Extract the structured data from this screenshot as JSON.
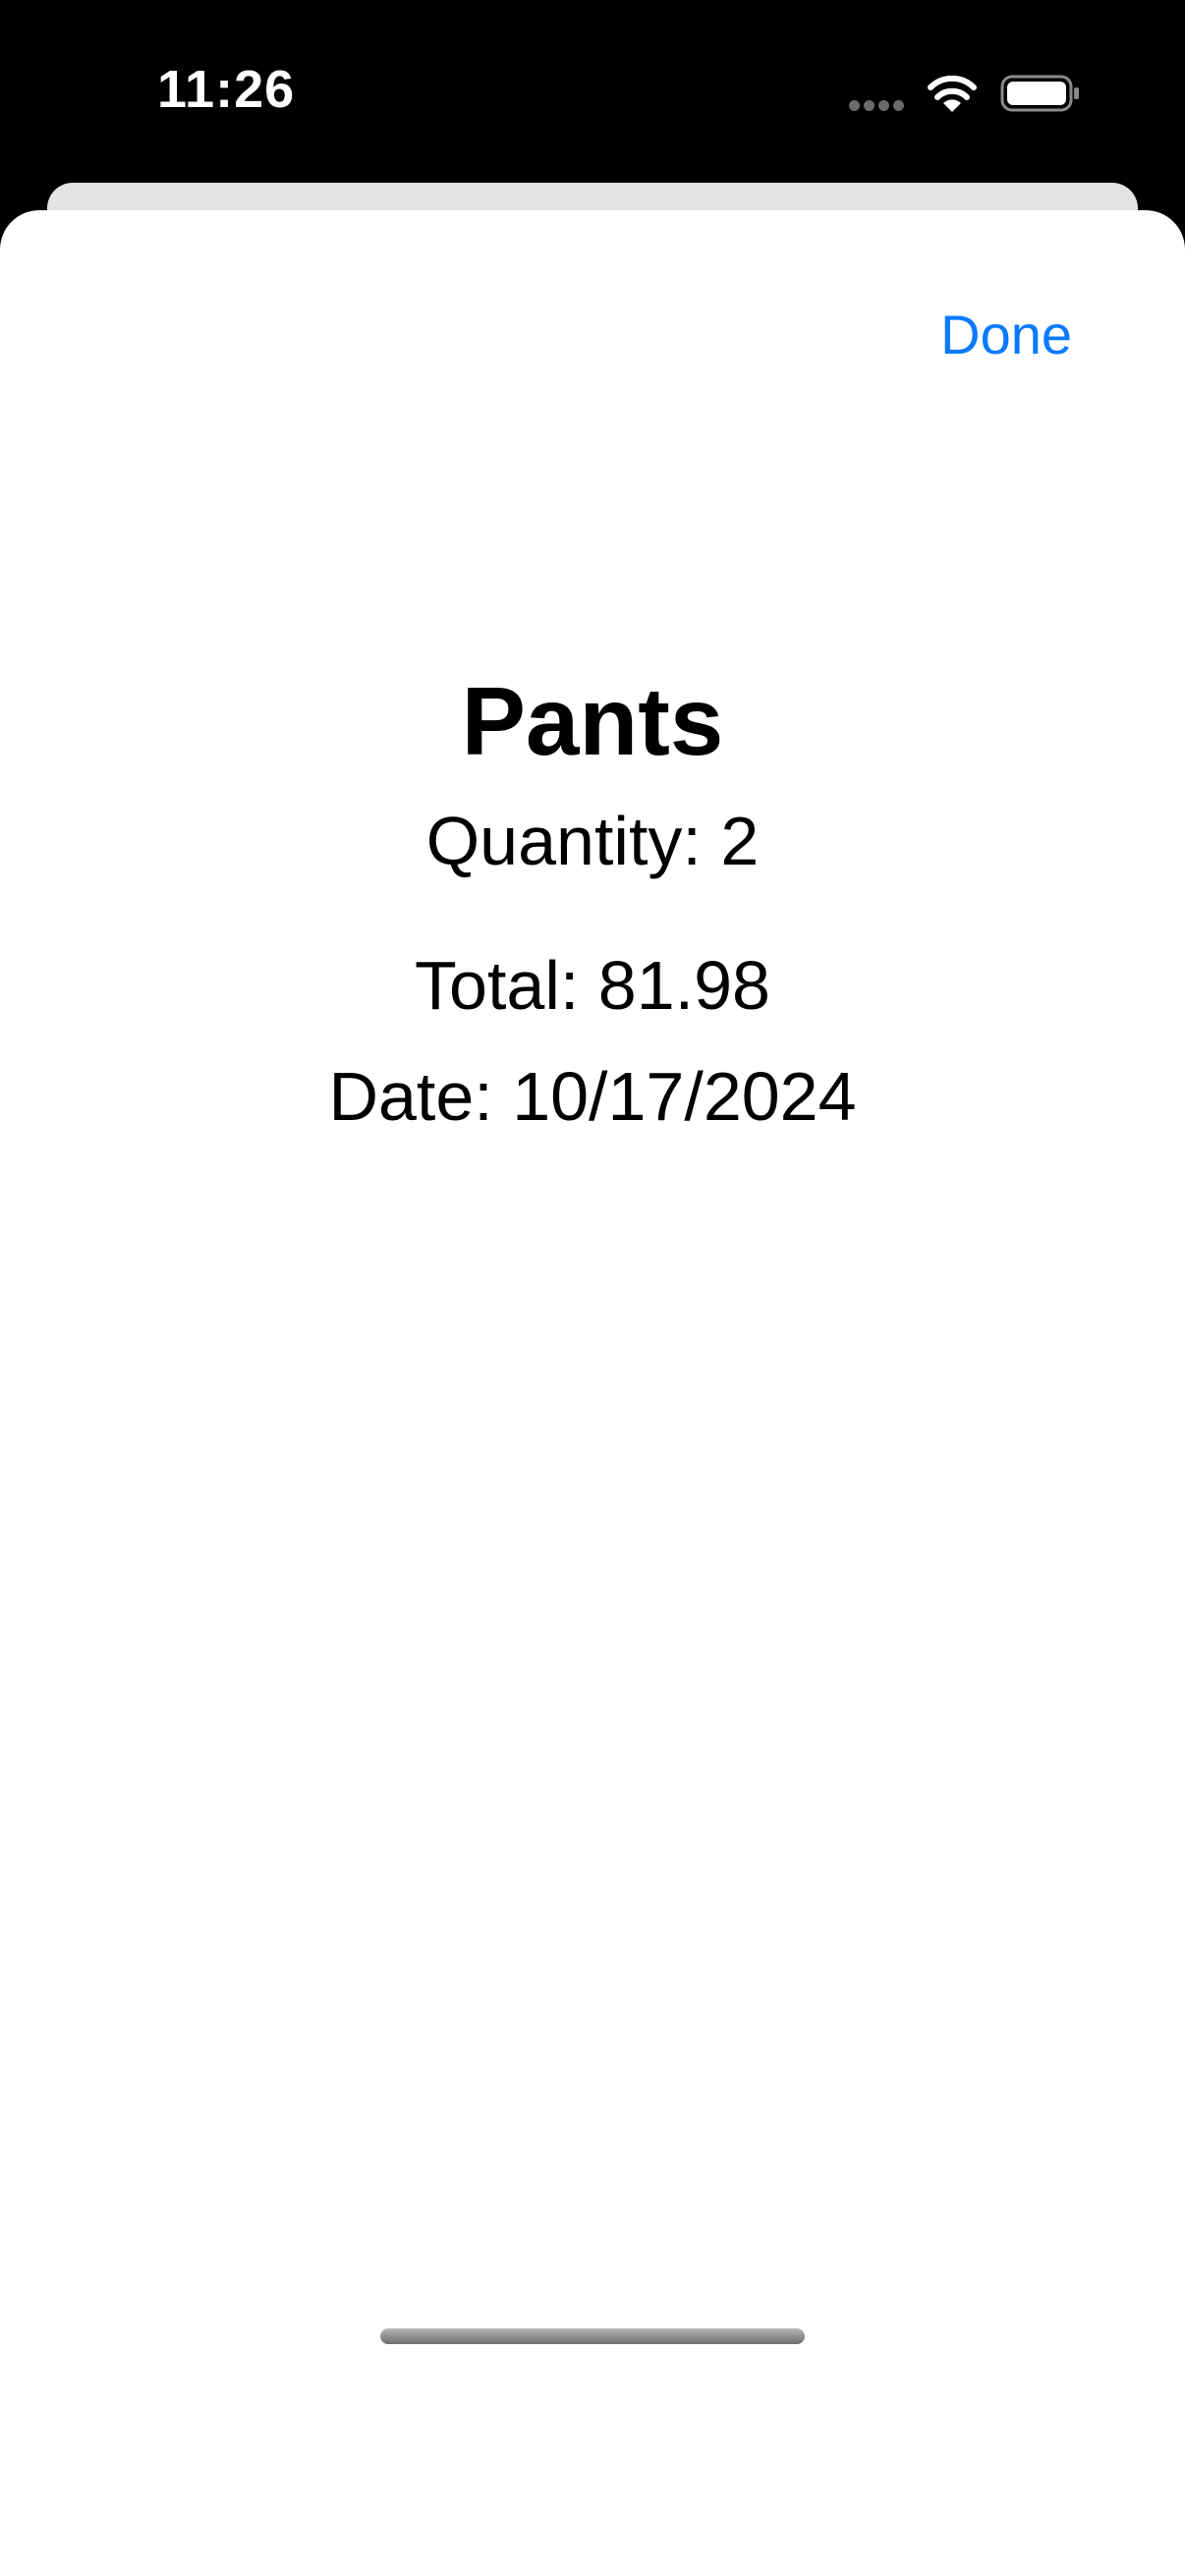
{
  "status_bar": {
    "time": "11:26",
    "icons": [
      "cellular-signal-icon",
      "wifi-icon",
      "battery-icon"
    ]
  },
  "sheet": {
    "done_label": "Done",
    "item": {
      "title": "Pants",
      "quantity": "Quantity: 2",
      "total": "Total: 81.98",
      "date": "Date: 10/17/2024"
    }
  },
  "colors": {
    "accent": "#0a7aff",
    "background": "#ffffff",
    "status_bar": "#000000"
  }
}
